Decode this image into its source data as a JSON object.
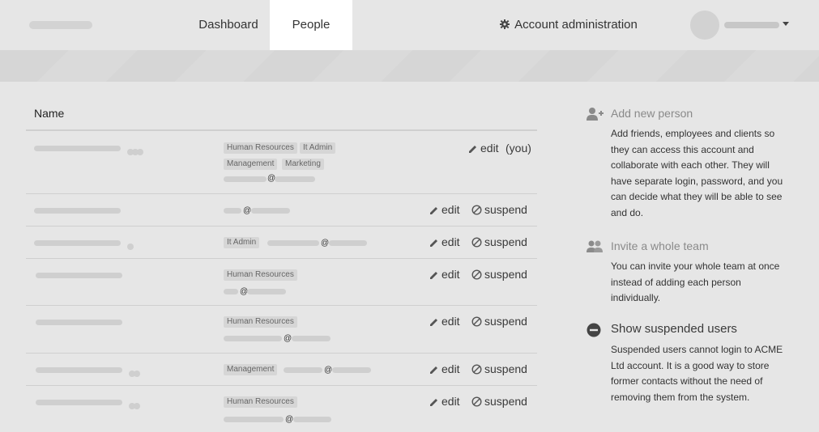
{
  "nav": {
    "dashboard": "Dashboard",
    "people": "People",
    "account_admin": "Account administration"
  },
  "table": {
    "header_name": "Name",
    "rows": [
      {
        "tags": [
          "Human Resources",
          "It Admin",
          "Management",
          "Marketing"
        ],
        "email_at": "@",
        "actions": [
          "edit",
          "(you)"
        ]
      },
      {
        "tags": [],
        "email_at": "@",
        "actions": [
          "edit",
          "suspend"
        ]
      },
      {
        "tags": [
          "It Admin"
        ],
        "email_at": "@",
        "actions": [
          "edit",
          "suspend"
        ]
      },
      {
        "tags": [
          "Human Resources"
        ],
        "email_at": "@",
        "actions": [
          "edit",
          "suspend"
        ]
      },
      {
        "tags": [
          "Human Resources"
        ],
        "email_at": "@",
        "actions": [
          "edit",
          "suspend"
        ]
      },
      {
        "tags": [
          "Management"
        ],
        "email_at": "@",
        "actions": [
          "edit",
          "suspend"
        ]
      },
      {
        "tags": [
          "Human Resources"
        ],
        "email_at": "@",
        "actions": [
          "edit",
          "suspend"
        ]
      }
    ]
  },
  "sidebar": {
    "add": {
      "title": "Add new person",
      "text": "Add friends, employees and clients so they can access this account and collaborate with each other. They will have separate login, password, and you can decide what they will be able to see and do."
    },
    "invite": {
      "title": "Invite a whole team",
      "text": "You can invite your whole team at once instead of adding each person individually."
    },
    "suspended": {
      "title": "Show suspended users",
      "text": "Suspended users cannot login to ACME Ltd account. It is a good way to store former contacts without the need of removing them from the system."
    }
  }
}
